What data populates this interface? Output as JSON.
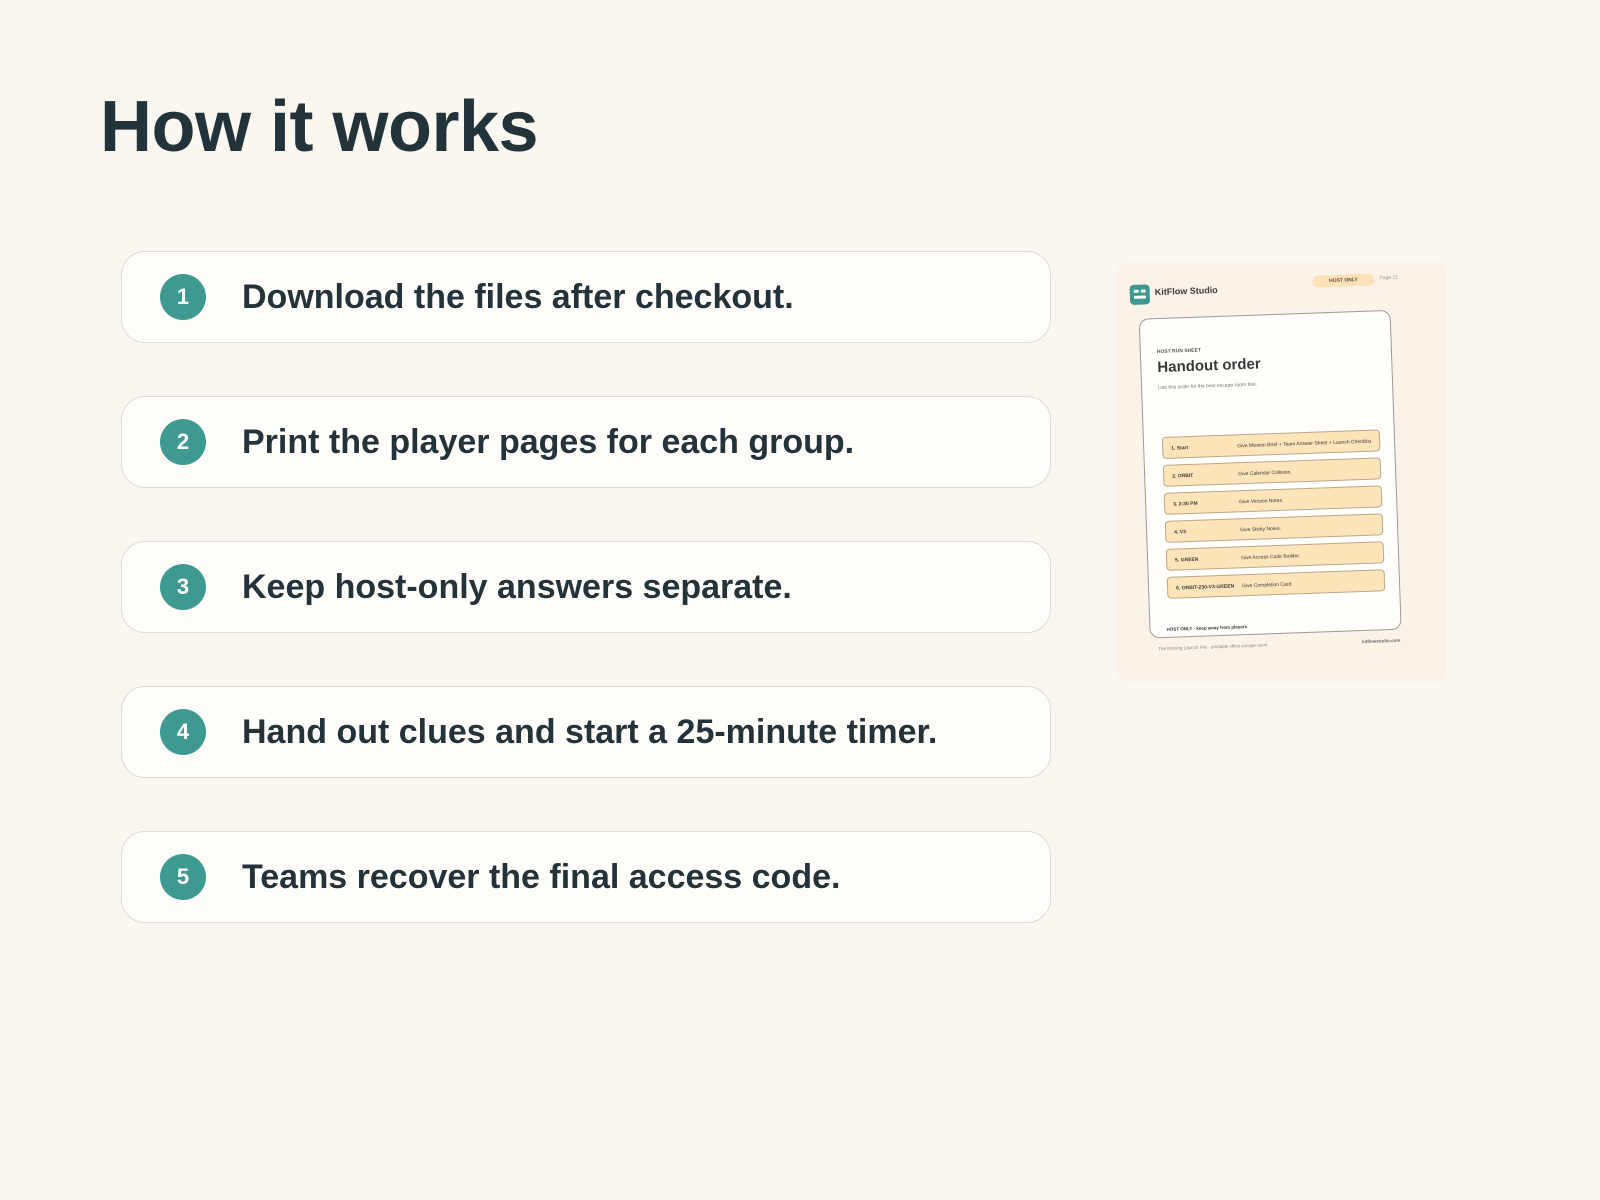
{
  "page": {
    "title": "How it works"
  },
  "steps": [
    {
      "number": "1",
      "text": "Download the files after checkout."
    },
    {
      "number": "2",
      "text": "Print the player pages for each group."
    },
    {
      "number": "3",
      "text": "Keep host-only answers separate."
    },
    {
      "number": "4",
      "text": "Hand out clues and start a 25-minute timer."
    },
    {
      "number": "5",
      "text": "Teams recover the final access code."
    }
  ],
  "preview": {
    "brand": "KitFlow Studio",
    "badge": "HOST ONLY",
    "page_label": "Page 11",
    "label": "HOST RUN SHEET",
    "title": "Handout order",
    "subtitle": "Use this order for the best escape-room feel.",
    "rows": [
      {
        "step": "1. Start",
        "action": "Give Mission Brief + Team Answer Sheet + Launch Checklist."
      },
      {
        "step": "2. ORBIT",
        "action": "Give Calendar Collision."
      },
      {
        "step": "3. 2:30 PM",
        "action": "Give Version Notes."
      },
      {
        "step": "4. V3",
        "action": "Give Sticky Notes."
      },
      {
        "step": "5. GREEN",
        "action": "Give Access Code Builder."
      },
      {
        "step": "6. ORBIT-230-V3-GREEN",
        "action": "Give Completion Card."
      }
    ],
    "note": "HOST ONLY - keep away from players",
    "footer_left": "The Missing Launch File - printable office escape room",
    "footer_right": "kitflowstudio.com"
  }
}
